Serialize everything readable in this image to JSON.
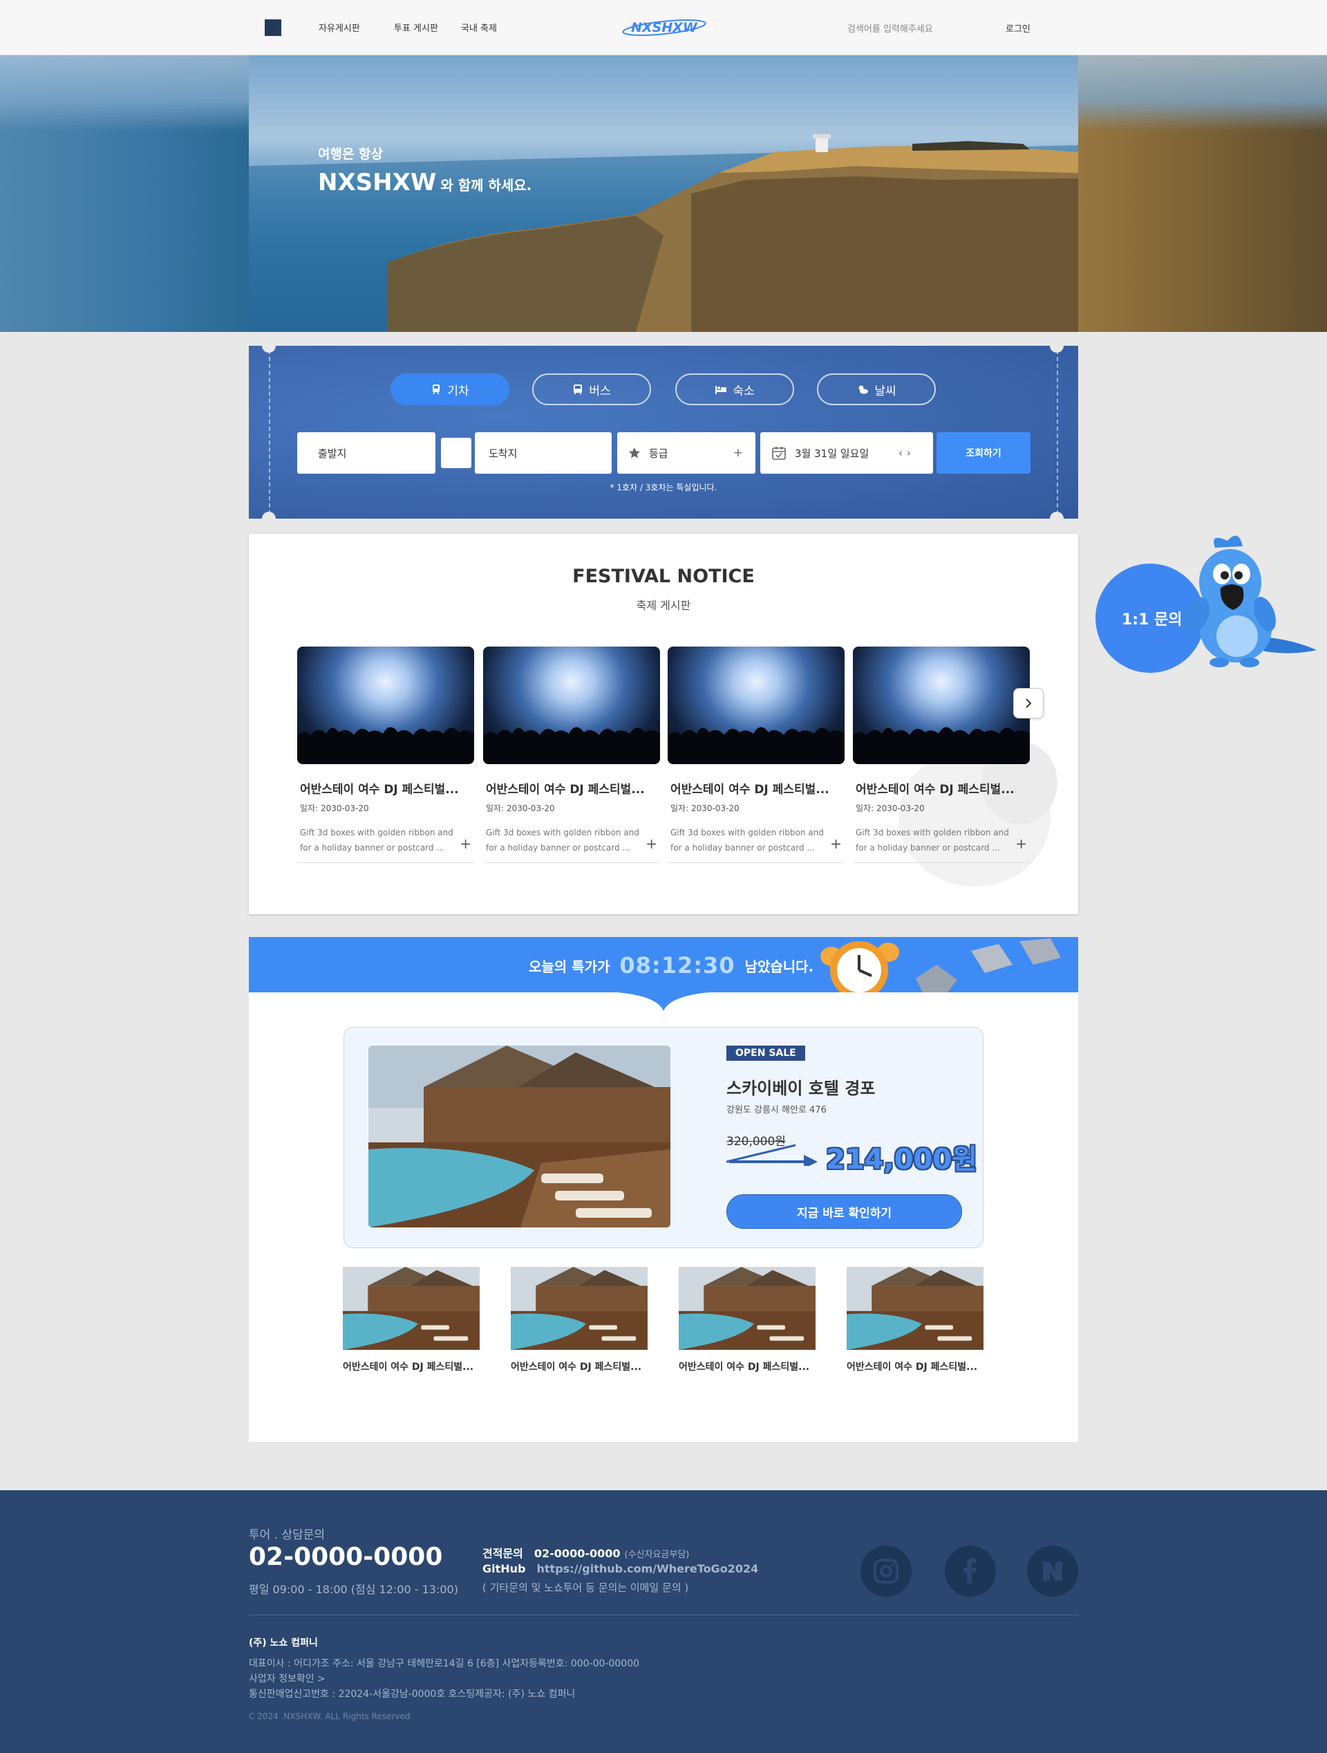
{
  "header": {
    "nav": [
      "자유게시판",
      "투표 게시판",
      "국내 축제"
    ],
    "logo": "NXSHXW",
    "search_placeholder": "검색어를 입력해주세요",
    "login": "로그인"
  },
  "hero": {
    "subtitle": "여행은 항상",
    "title_brand": "NXSHXW",
    "title_rest": "와 함께 하세요."
  },
  "booking": {
    "tabs": [
      {
        "label": "기차",
        "icon": "train-icon",
        "active": true
      },
      {
        "label": "버스",
        "icon": "bus-icon",
        "active": false
      },
      {
        "label": "숙소",
        "icon": "bed-icon",
        "active": false
      },
      {
        "label": "날씨",
        "icon": "weather-icon",
        "active": false
      }
    ],
    "departure": "출발지",
    "arrival": "도착지",
    "grade": "등급",
    "grade_plus": "+",
    "date": "3월 31일 일요일",
    "search_button": "조회하기",
    "note": "* 1호차 / 3호차는 특실입니다."
  },
  "festival": {
    "title": "FESTIVAL NOTICE",
    "subtitle": "축제 게시판",
    "cards": [
      {
        "title": "어반스테이 여수 DJ 페스티벌...",
        "date": "일자: 2030-03-20",
        "desc": "Gift 3d boxes with golden ribbon and for a holiday banner or postcard ..."
      },
      {
        "title": "어반스테이 여수 DJ 페스티벌...",
        "date": "일자: 2030-03-20",
        "desc": "Gift 3d boxes with golden ribbon and for a holiday banner or postcard ..."
      },
      {
        "title": "어반스테이 여수 DJ 페스티벌...",
        "date": "일자: 2030-03-20",
        "desc": "Gift 3d boxes with golden ribbon and for a holiday banner or postcard ..."
      },
      {
        "title": "어반스테이 여수 DJ 페스티벌...",
        "date": "일자: 2030-03-20",
        "desc": "Gift 3d boxes with golden ribbon and for a holiday banner or postcard ..."
      }
    ],
    "plus": "+"
  },
  "inquiry": {
    "label": "1:1 문의"
  },
  "deal": {
    "prefix": "오늘의 특가가",
    "timer": "08:12:30",
    "suffix": "남았습니다.",
    "badge": "OPEN SALE",
    "hotel": "스카이베이 호텔 경포",
    "address": "강원도 강릉시 해안로 476",
    "old_price": "320,000원",
    "new_price": "214,000원",
    "button": "지금 바로 확인하기",
    "thumbs": [
      "어반스테이 여수 DJ 페스티벌...",
      "어반스테이 여수 DJ 페스티벌...",
      "어반스테이 여수 DJ 페스티벌...",
      "어반스테이 여수 DJ 페스티벌..."
    ]
  },
  "footer": {
    "consult_label": "투어 . 상담문의",
    "phone": "02-0000-0000",
    "hours": "평일 09:00 - 18:00 (점심 12:00 - 13:00)",
    "quote_label": "견적문의",
    "quote_phone": "02-0000-0000",
    "quote_note": "(수신자요금부담)",
    "github_label": "GitHub",
    "github_url": "https://github.com/WhereToGo2024",
    "etc": "( 기타문의 및 노쇼투어 등 문의는 이메일 문의 )",
    "company": "(주) 노쇼 컴퍼니",
    "info1": "대표이사 : 어디가조    주소: 서울 강남구 테헤란로14길 6 [6층]    사업자등록번호: 000-00-00000",
    "info2": "사업자 정보확인 >",
    "info3": "통신판매업신고번호 : 22024-서울강남-0000호    호스팅제공자: (주) 노쇼 컴퍼니",
    "copyright": "C 2024 .NXSHXW. ALL Rights Reserved",
    "social": [
      "instagram-icon",
      "facebook-icon",
      "naver-icon"
    ]
  }
}
